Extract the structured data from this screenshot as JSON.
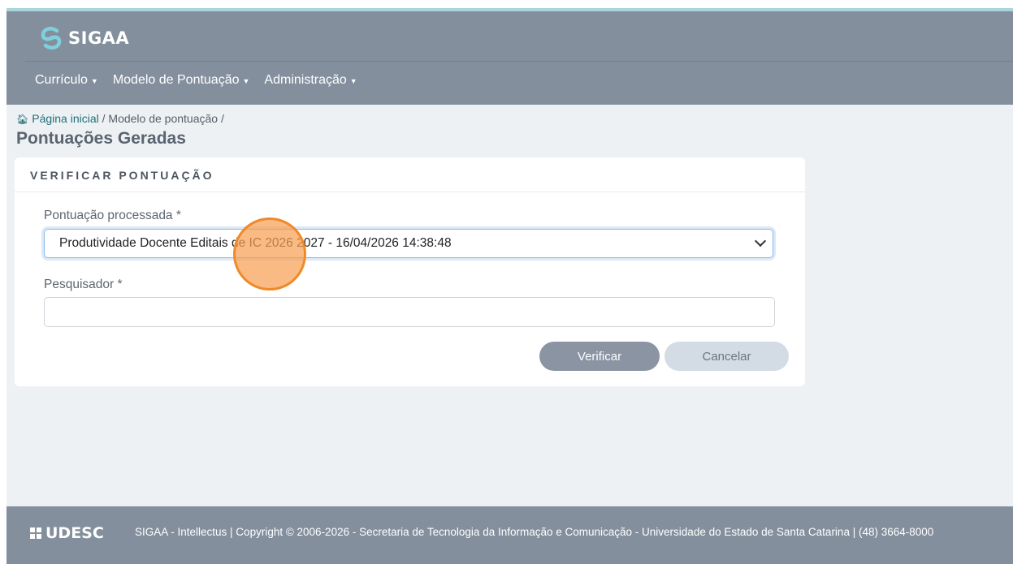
{
  "brand": {
    "name": "SIGAA"
  },
  "menu": [
    {
      "label": "Currículo"
    },
    {
      "label": "Modelo de Pontuação"
    },
    {
      "label": "Administração"
    }
  ],
  "breadcrumb": {
    "home": "Página inicial",
    "sep1": "/",
    "current": "Modelo de pontuação",
    "sep2": "/"
  },
  "page": {
    "title": "Pontuações Geradas"
  },
  "form": {
    "section_title": "VERIFICAR PONTUAÇÃO",
    "pontuacao_label": "Pontuação processada *",
    "pontuacao_value": "Produtividade Docente Editais de IC 2026 2027 - 16/04/2026 14:38:48",
    "pesquisador_label": "Pesquisador *",
    "pesquisador_value": "",
    "verify_label": "Verificar",
    "cancel_label": "Cancelar"
  },
  "footer": {
    "logo": "UDESC",
    "text": "SIGAA - Intellectus | Copyright © 2006-2026 - Secretaria de Tecnologia da Informação e Comunicação - Universidade do Estado de Santa Catarina | (48) 3664-8000"
  },
  "colors": {
    "header_bg": "#838f9d",
    "page_bg": "#eef1f4",
    "accent_link": "#1e6f78",
    "cursor_highlight": "#f08a28"
  }
}
